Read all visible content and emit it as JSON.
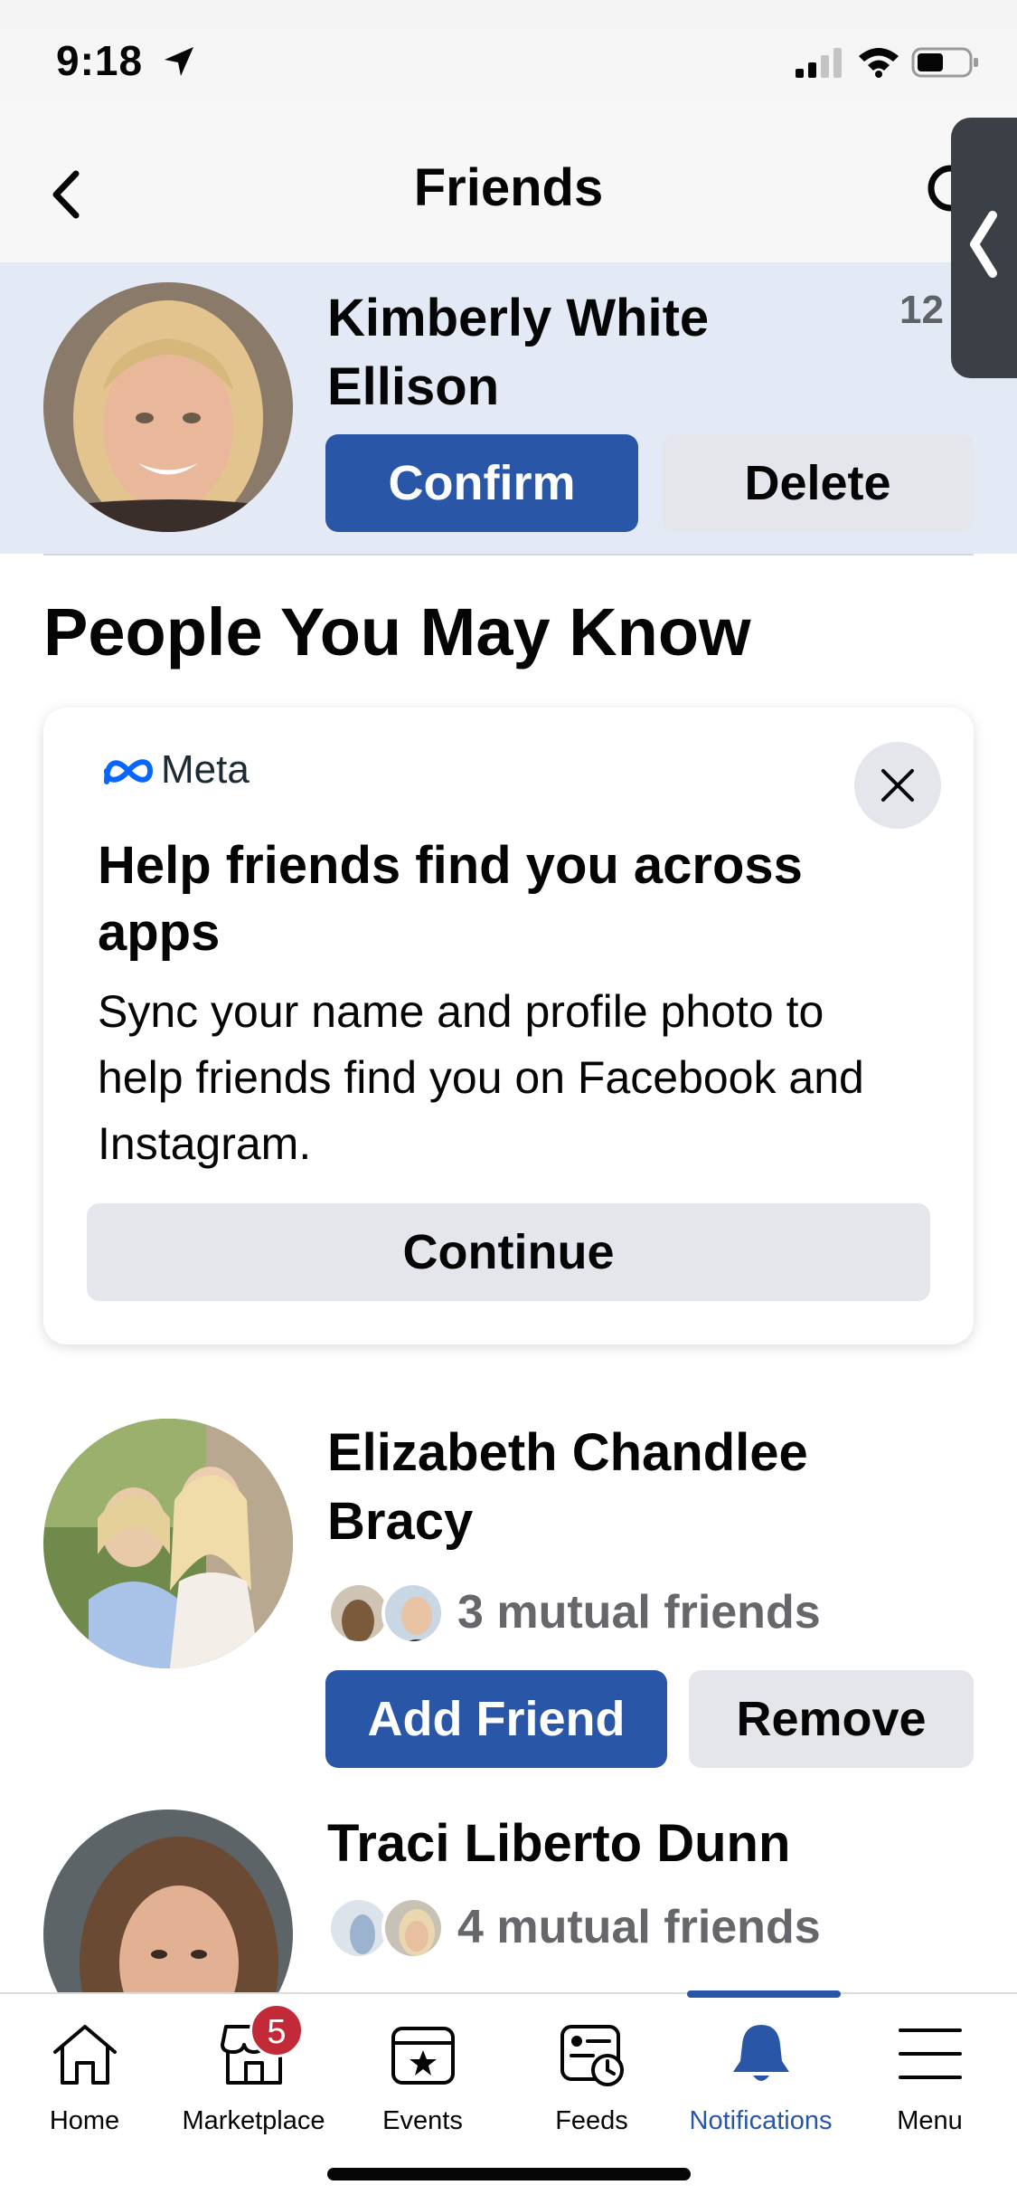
{
  "status_bar": {
    "time": "9:18"
  },
  "header": {
    "title": "Friends"
  },
  "friend_request": {
    "name": "Kimberly White Ellison",
    "time": "12",
    "confirm_label": "Confirm",
    "delete_label": "Delete"
  },
  "section": {
    "title": "People You May Know"
  },
  "meta_card": {
    "brand": "Meta",
    "title": "Help friends find you across apps",
    "body": "Sync your name and profile photo to help friends find you on Facebook and Instagram.",
    "continue_label": "Continue"
  },
  "people": [
    {
      "name": "Elizabeth Chandlee Bracy",
      "mutual": "3 mutual friends",
      "add_label": "Add Friend",
      "remove_label": "Remove"
    },
    {
      "name": "Traci Liberto Dunn",
      "mutual": "4 mutual friends"
    }
  ],
  "tabbar": {
    "items": [
      {
        "label": "Home",
        "icon": "home-icon"
      },
      {
        "label": "Marketplace",
        "icon": "marketplace-icon",
        "badge": "5"
      },
      {
        "label": "Events",
        "icon": "events-icon"
      },
      {
        "label": "Feeds",
        "icon": "feeds-icon"
      },
      {
        "label": "Notifications",
        "icon": "bell-icon",
        "active": true
      },
      {
        "label": "Menu",
        "icon": "menu-icon"
      }
    ]
  },
  "colors": {
    "accent": "#2a56a8",
    "request_bg": "#e4eaf5",
    "badge": "#c22a38",
    "secondary_button": "#e4e6eb"
  }
}
